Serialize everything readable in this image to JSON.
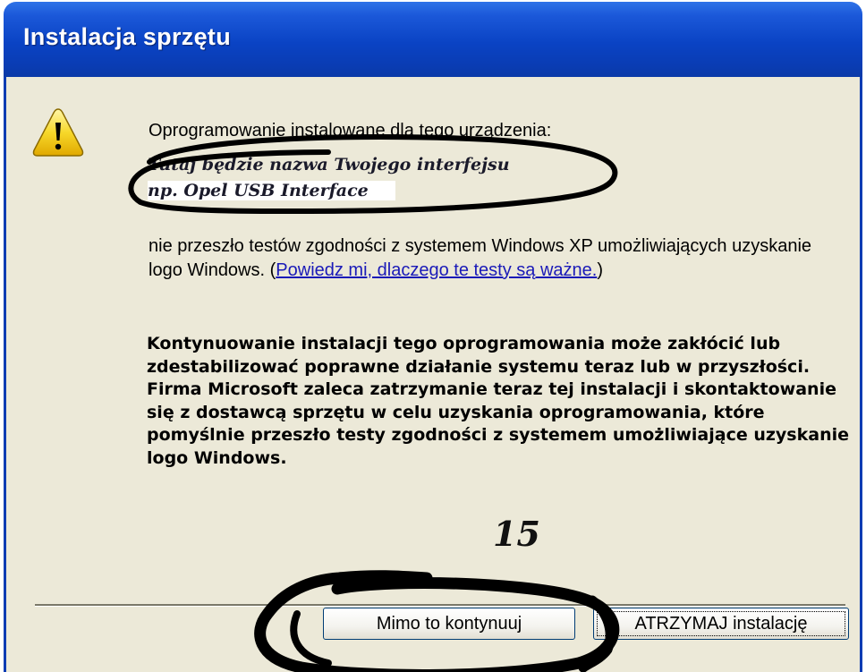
{
  "window": {
    "title": "Instalacja sprzętu"
  },
  "dialog": {
    "icon": "warning-triangle-icon",
    "intro": "Oprogramowanie instalowane dla tego urządzenia:",
    "device_name_line1": "Tutaj będzie nazwa Twojego interfejsu",
    "device_name_line2": "np. Opel USB Interface",
    "compat_text": "nie przeszło testów zgodności z systemem Windows XP umożliwiających uzyskanie logo Windows. (",
    "why_link": "Powiedz mi, dlaczego te testy są ważne.",
    "compat_text_end": ")",
    "warning": "Kontynuowanie instalacji tego oprogramowania może zakłócić lub zdestabilizować poprawne działanie systemu teraz lub w przyszłości. Firma Microsoft zaleca zatrzymanie teraz tej instalacji i skontaktowanie się z dostawcą sprzętu w celu uzyskania oprogramowania, które pomyślnie przeszło testy zgodności z systemem umożliwiające uzyskanie logo Windows.",
    "step_number": "15"
  },
  "buttons": {
    "continue_label": "Mimo to kontynuuj",
    "stop_label": "ATRZYMAJ instalację"
  },
  "colors": {
    "titlebar": "#0a43c4",
    "client_bg": "#ece9d8",
    "link": "#1a1ab8",
    "annotation_ink": "#000000"
  }
}
